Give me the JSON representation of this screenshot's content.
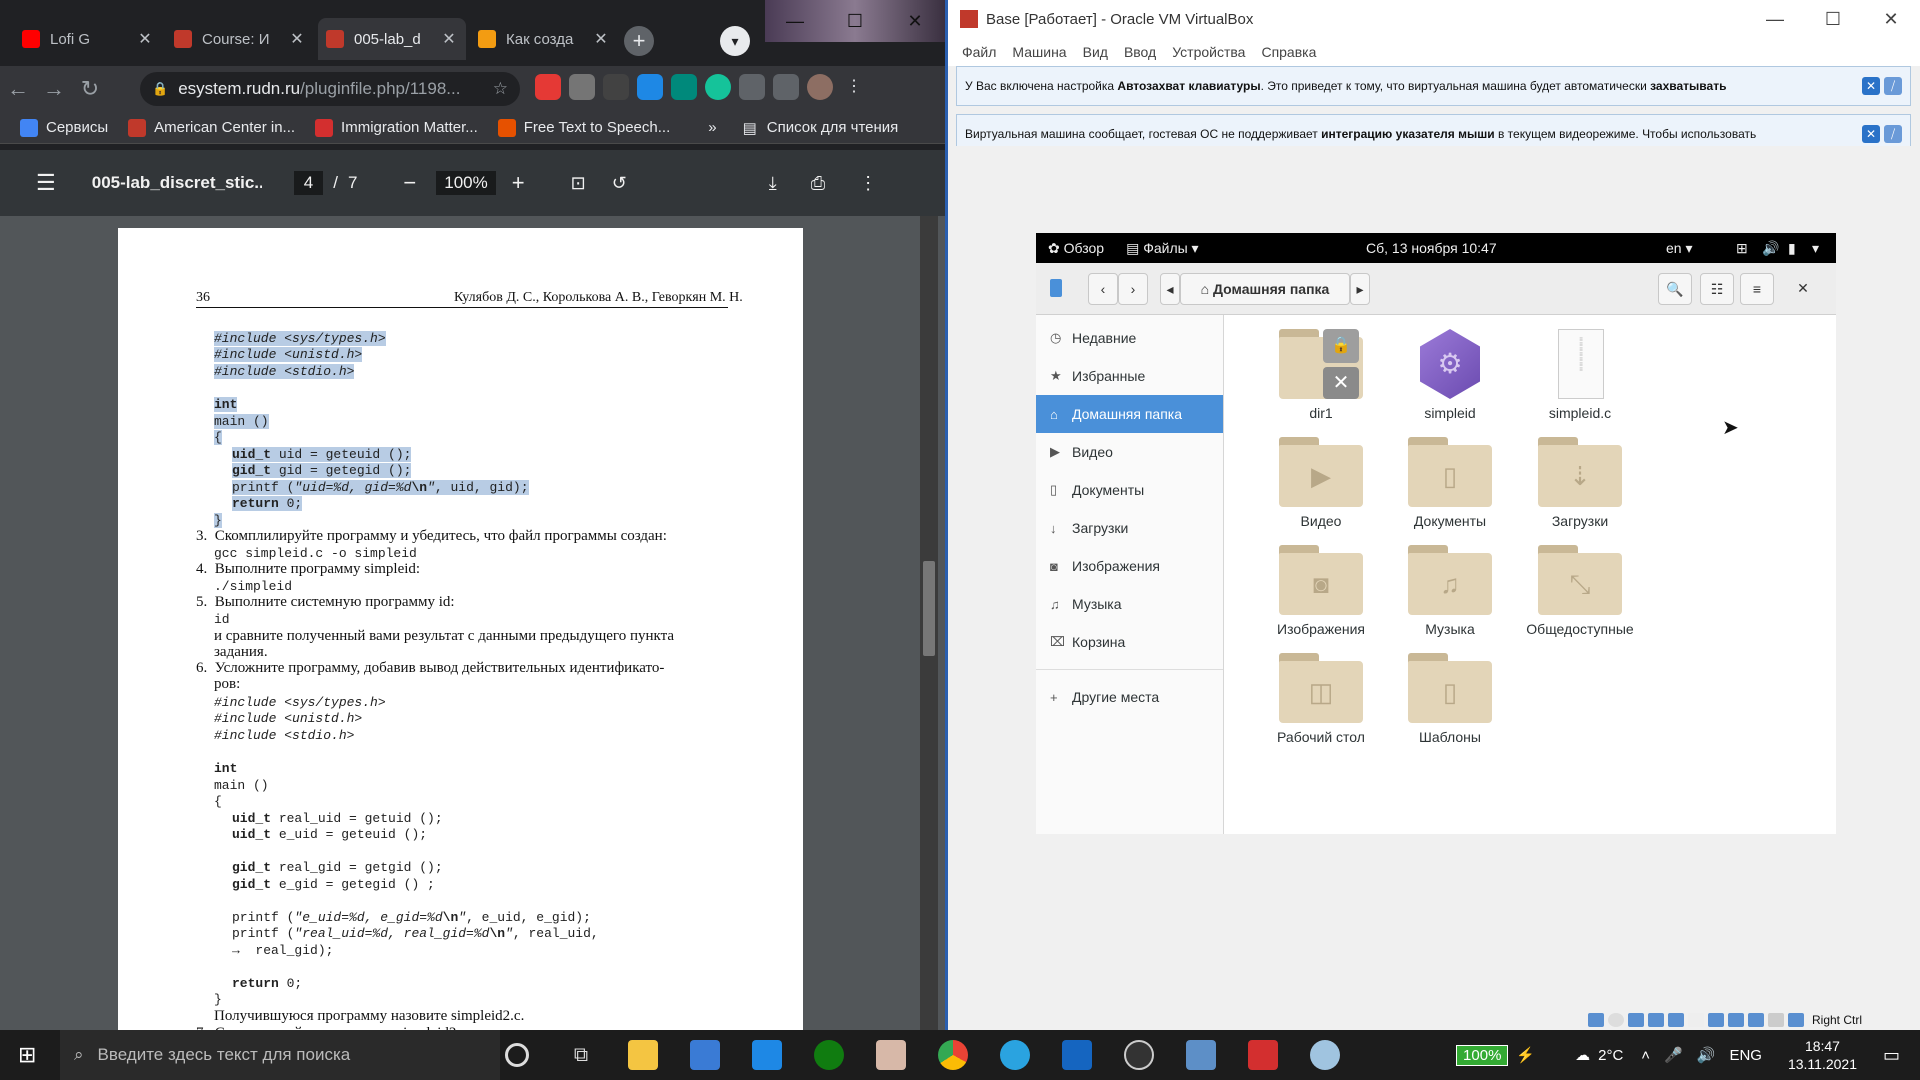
{
  "chrome": {
    "tabs": [
      {
        "label": "Lofi G",
        "icon": "youtube-icon",
        "color": "#ff0000",
        "active": false
      },
      {
        "label": "Course: И",
        "icon": "moodle-icon",
        "color": "#c0392b",
        "active": false
      },
      {
        "label": "005-lab_d",
        "icon": "pdf-icon",
        "color": "#c0392b",
        "active": true
      },
      {
        "label": "Как созда",
        "icon": "bookmark-icon",
        "color": "#f39c12",
        "active": false
      }
    ],
    "url_domain": "esystem.rudn.ru",
    "url_path": "/pluginfile.php/1198...",
    "bookmarks": [
      {
        "label": "Сервисы",
        "icon": "apps-grid-icon",
        "color": "#4285f4"
      },
      {
        "label": "American Center in...",
        "icon": "person-icon",
        "color": "#c0392b"
      },
      {
        "label": "Immigration Matter...",
        "icon": "maple-leaf-icon",
        "color": "#d32f2f"
      },
      {
        "label": "Free Text to Speech...",
        "icon": "tts-icon",
        "color": "#e65100"
      }
    ],
    "bookmarks_more": "»",
    "reading_list": "Список для чтения"
  },
  "pdf": {
    "filename": "005-lab_discret_stic...",
    "page_current": "4",
    "page_sep": "/",
    "page_total": "7",
    "zoom": "100%",
    "header_page": "36",
    "header_authors": "Кулябов Д. С., Королькова А. В., Геворкян М. Н."
  },
  "vbox": {
    "title": "Base [Работает] - Oracle VM VirtualBox",
    "menu": [
      "Файл",
      "Машина",
      "Вид",
      "Ввод",
      "Устройства",
      "Справка"
    ],
    "notice1_a": "У Вас включена настройка ",
    "notice1_b": "Автозахват клавиатуры",
    "notice1_c": ". Это приведет к тому, что виртуальная машина будет автоматически ",
    "notice1_d": "захватывать",
    "notice2_a": "Виртуальная машина сообщает, гостевая ОС не поддерживает ",
    "notice2_b": "интеграцию указателя мыши",
    "notice2_c": " в текущем видеорежиме. Чтобы использовать",
    "host_key": "Right Ctrl"
  },
  "gnome": {
    "overview": "Обзор",
    "app_menu": "Файлы",
    "clock": "Сб, 13 ноября 10:47",
    "lang": "en",
    "location": "Домашняя папка",
    "sidebar": [
      {
        "label": "Недавние",
        "icon": "clock-icon",
        "g": "◷"
      },
      {
        "label": "Избранные",
        "icon": "star-icon",
        "g": "★"
      },
      {
        "label": "Домашняя папка",
        "icon": "home-icon",
        "g": "⌂"
      },
      {
        "label": "Видео",
        "icon": "video-icon",
        "g": "▶"
      },
      {
        "label": "Документы",
        "icon": "document-icon",
        "g": "▯"
      },
      {
        "label": "Загрузки",
        "icon": "download-icon",
        "g": "↓"
      },
      {
        "label": "Изображения",
        "icon": "camera-icon",
        "g": "◙"
      },
      {
        "label": "Музыка",
        "icon": "music-icon",
        "g": "♫"
      },
      {
        "label": "Корзина",
        "icon": "trash-icon",
        "g": "🗑"
      }
    ],
    "other_places": "Другие места",
    "files": [
      {
        "label": "dir1",
        "icon": "locked-folder-icon"
      },
      {
        "label": "simpleid",
        "icon": "executable-icon"
      },
      {
        "label": "simpleid.c",
        "icon": "text-file-icon"
      },
      {
        "label": "Видео",
        "icon": "video-folder-icon"
      },
      {
        "label": "Документы",
        "icon": "documents-folder-icon"
      },
      {
        "label": "Загрузки",
        "icon": "downloads-folder-icon"
      },
      {
        "label": "Изображения",
        "icon": "pictures-folder-icon"
      },
      {
        "label": "Музыка",
        "icon": "music-folder-icon"
      },
      {
        "label": "Общедоступные",
        "icon": "public-folder-icon"
      },
      {
        "label": "Рабочий стол",
        "icon": "desktop-folder-icon"
      },
      {
        "label": "Шаблоны",
        "icon": "templates-folder-icon"
      }
    ]
  },
  "taskbar": {
    "search_placeholder": "Введите здесь текст для поиска",
    "battery": "100%",
    "temp": "2°C",
    "lang": "ENG",
    "time": "18:47",
    "date": "13.11.2021"
  }
}
